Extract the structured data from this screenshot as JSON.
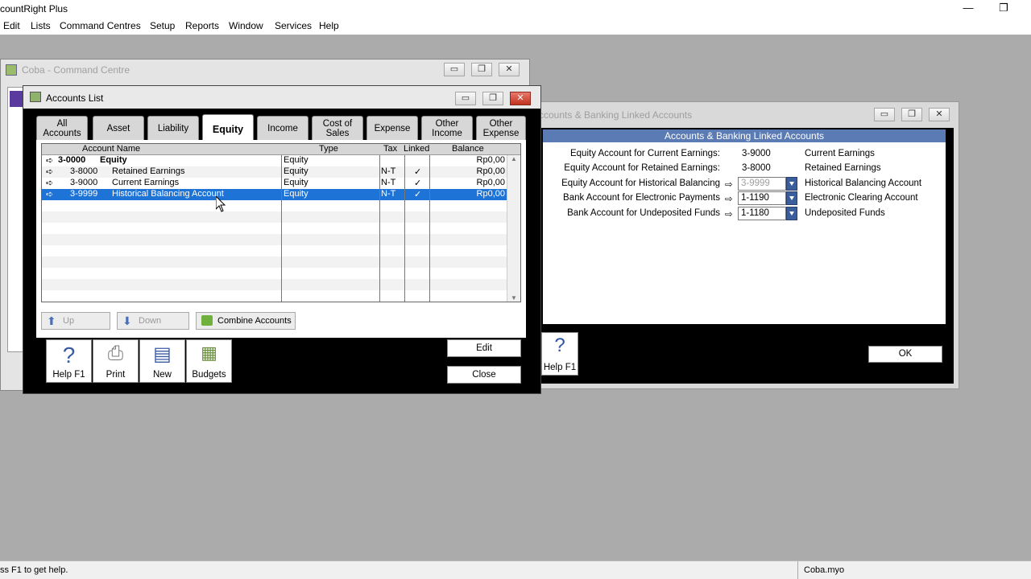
{
  "app": {
    "title": "countRight Plus",
    "minimize": "—",
    "restore": "❐"
  },
  "menu": [
    "Edit",
    "Lists",
    "Command Centres",
    "Setup",
    "Reports",
    "Window",
    "Services",
    "Help"
  ],
  "command_centre": {
    "title": "Coba - Command Centre"
  },
  "linked": {
    "title": "ccounts & Banking Linked Accounts",
    "header": "Accounts & Banking Linked Accounts",
    "rows": [
      {
        "label": "Equity Account for Current Earnings:",
        "code": "3-9000",
        "desc": "Current Earnings"
      },
      {
        "label": "Equity Account for Retained Earnings:",
        "code": "3-8000",
        "desc": "Retained Earnings"
      },
      {
        "label": "Equity Account for Historical Balancing",
        "code": "3-9999",
        "desc": "Historical Balancing Account"
      },
      {
        "label": "Bank Account for Electronic Payments",
        "code": "1-1190",
        "desc": "Electronic Clearing Account"
      },
      {
        "label": "Bank Account for Undeposited Funds",
        "code": "1-1180",
        "desc": "Undeposited Funds"
      }
    ],
    "help_label": "Help F1",
    "ok_label": "OK"
  },
  "accounts": {
    "title": "Accounts List",
    "tabs": [
      {
        "line1": "All",
        "line2": "Accounts"
      },
      {
        "line1": "Asset",
        "line2": ""
      },
      {
        "line1": "Liability",
        "line2": ""
      },
      {
        "line1": "Equity",
        "line2": ""
      },
      {
        "line1": "Income",
        "line2": ""
      },
      {
        "line1": "Cost of",
        "line2": "Sales"
      },
      {
        "line1": "Expense",
        "line2": ""
      },
      {
        "line1": "Other",
        "line2": "Income"
      },
      {
        "line1": "Other",
        "line2": "Expense"
      }
    ],
    "columns": {
      "name": "Account Name",
      "type": "Type",
      "tax": "Tax",
      "linked": "Linked",
      "balance": "Balance"
    },
    "rows": [
      {
        "arrow": "➪",
        "number": "3-0000",
        "name": "Equity",
        "type": "Equity",
        "tax": "",
        "linked": "",
        "balance": "Rp0,00"
      },
      {
        "arrow": "➪",
        "number": "3-8000",
        "name": "Retained Earnings",
        "type": "Equity",
        "tax": "N-T",
        "linked": "✓",
        "balance": "Rp0,00"
      },
      {
        "arrow": "➪",
        "number": "3-9000",
        "name": "Current Earnings",
        "type": "Equity",
        "tax": "N-T",
        "linked": "✓",
        "balance": "Rp0,00"
      },
      {
        "arrow": "➪",
        "number": "3-9999",
        "name": "Historical Balancing Account",
        "type": "Equity",
        "tax": "N-T",
        "linked": "✓",
        "balance": "Rp0,00"
      }
    ],
    "buttons": {
      "up": "Up",
      "down": "Down",
      "combine": "Combine Accounts",
      "edit": "Edit",
      "close": "Close"
    },
    "toolbar": [
      {
        "label": "Help F1",
        "icon": "help-icon"
      },
      {
        "label": "Print",
        "icon": "printer-icon"
      },
      {
        "label": "New",
        "icon": "new-icon"
      },
      {
        "label": "Budgets",
        "icon": "budgets-icon"
      }
    ]
  },
  "status": {
    "hint": "ss F1 to get help.",
    "file": "Coba.myo"
  },
  "colors": {
    "selection": "#1e73d6",
    "panel_header": "#5b7bb4",
    "mdi_background": "#ababab"
  }
}
